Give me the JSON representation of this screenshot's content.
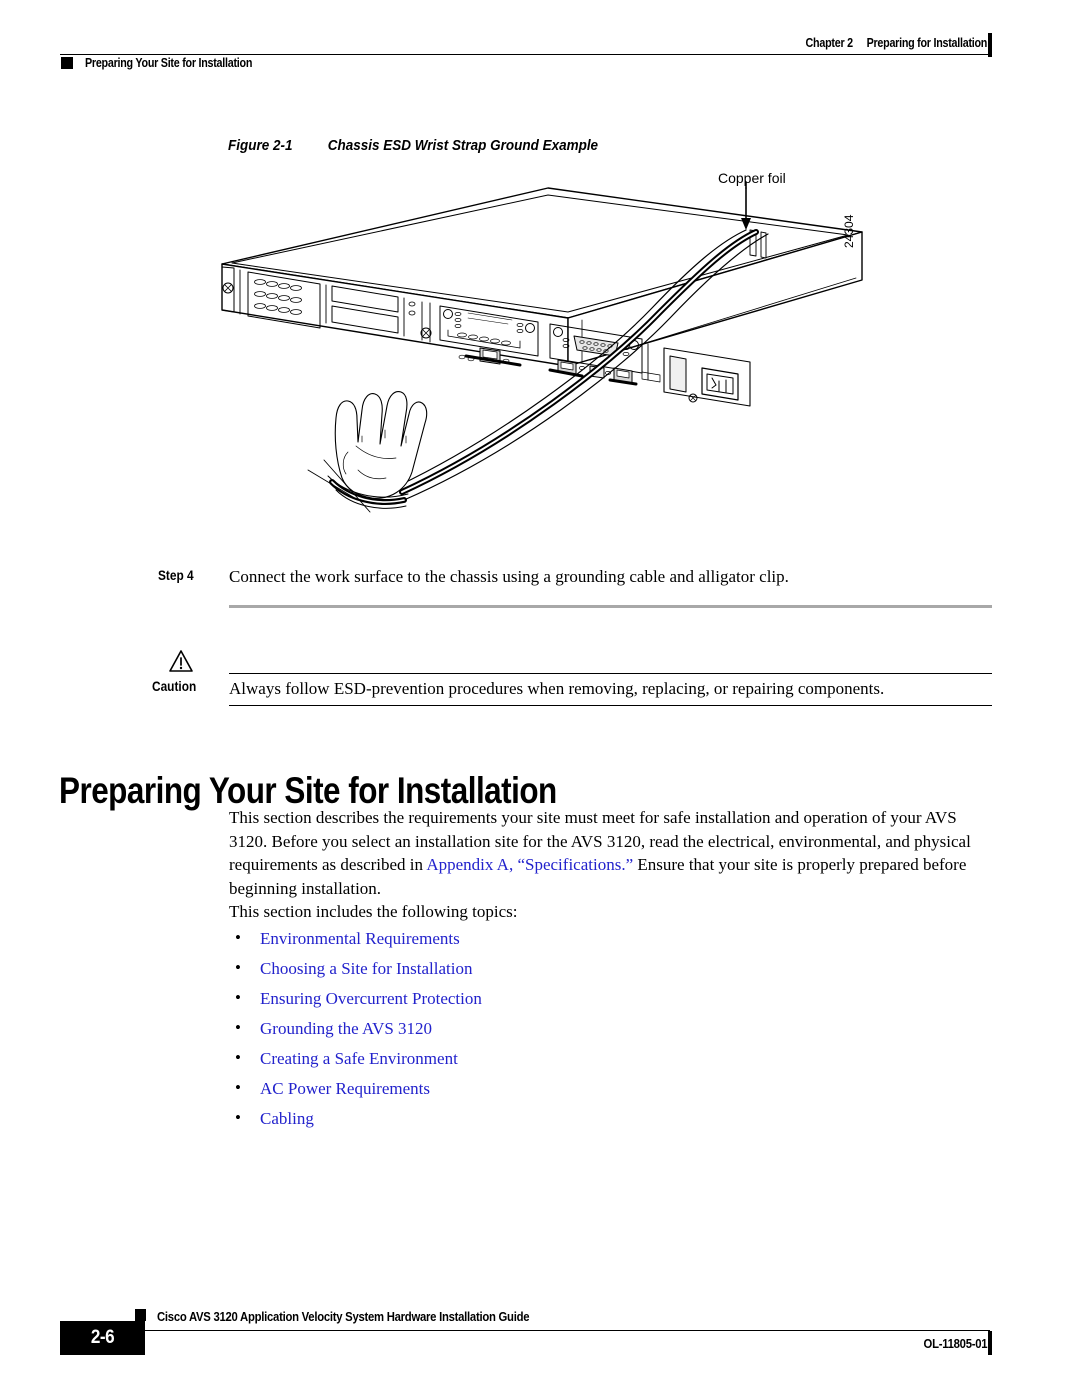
{
  "header": {
    "chapter_number": "Chapter 2",
    "chapter_title": "Preparing for Installation",
    "running_head": "Preparing Your Site for Installation"
  },
  "figure": {
    "number": "Figure 2-1",
    "title": "Chassis ESD Wrist Strap Ground Example",
    "callout_copper_foil": "Copper foil",
    "figure_id": "24304",
    "alt": "Isometric line drawing of a 1RU AVS 3120 chassis with an ESD wrist strap cable running from a hand to copper foil on the chassis top edge"
  },
  "step": {
    "label": "Step 4",
    "text": "Connect the work surface to the chassis using a grounding cable and alligator clip."
  },
  "caution": {
    "label": "Caution",
    "icon": "warning-triangle-icon",
    "text": "Always follow ESD-prevention procedures when removing, replacing, or repairing components."
  },
  "section": {
    "heading": "Preparing Your Site for Installation",
    "paragraph_part1": "This section describes the requirements your site must meet for safe installation and operation of your AVS 3120. Before you select an installation site for the AVS 3120, read the electrical, environmental, and physical requirements as described in ",
    "paragraph_link": "Appendix A, “Specifications.”",
    "paragraph_part2": " Ensure that your site is properly prepared before beginning installation.",
    "topics_intro": "This section includes the following topics:",
    "topics": [
      {
        "label": "Environmental Requirements"
      },
      {
        "label": "Choosing a Site for Installation"
      },
      {
        "label": "Ensuring Overcurrent Protection"
      },
      {
        "label": "Grounding the AVS 3120"
      },
      {
        "label": "Creating a Safe Environment"
      },
      {
        "label": "AC Power Requirements"
      },
      {
        "label": "Cabling"
      }
    ]
  },
  "footer": {
    "page_number": "2-6",
    "document_title": "Cisco AVS 3120 Application Velocity System Hardware Installation Guide",
    "document_id": "OL-11805-01"
  },
  "colors": {
    "link": "#2222cc",
    "rule_gray": "#a8a8a8",
    "text": "#000000",
    "background": "#ffffff"
  }
}
